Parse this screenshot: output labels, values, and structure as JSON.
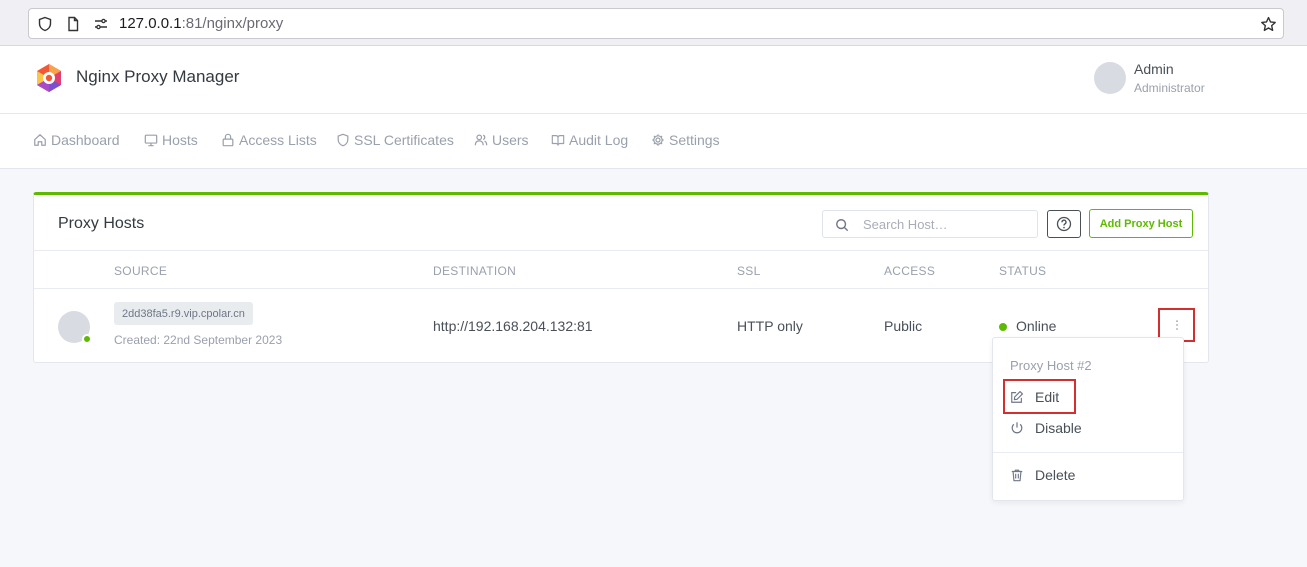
{
  "browser": {
    "url_host": "127.0.0.1",
    "url_rest": ":81/nginx/proxy"
  },
  "header": {
    "brand": "Nginx Proxy Manager",
    "user_name": "Admin",
    "user_role": "Administrator"
  },
  "nav": {
    "items": [
      {
        "label": "Dashboard",
        "icon": "home-icon"
      },
      {
        "label": "Hosts",
        "icon": "monitor-icon"
      },
      {
        "label": "Access Lists",
        "icon": "lock-icon"
      },
      {
        "label": "SSL Certificates",
        "icon": "shield-icon"
      },
      {
        "label": "Users",
        "icon": "users-icon"
      },
      {
        "label": "Audit Log",
        "icon": "book-icon"
      },
      {
        "label": "Settings",
        "icon": "gear-icon"
      }
    ]
  },
  "card": {
    "title": "Proxy Hosts",
    "search_placeholder": "Search Host…",
    "add_button": "Add Proxy Host",
    "columns": [
      "SOURCE",
      "DESTINATION",
      "SSL",
      "ACCESS",
      "STATUS"
    ]
  },
  "rows": [
    {
      "source": "2dd38fa5.r9.vip.cpolar.cn",
      "created": "Created: 22nd September 2023",
      "destination": "http://192.168.204.132:81",
      "ssl": "HTTP only",
      "access": "Public",
      "status": "Online"
    }
  ],
  "dropdown": {
    "header": "Proxy Host #2",
    "edit": "Edit",
    "disable": "Disable",
    "delete": "Delete"
  },
  "colors": {
    "accent": "#5eba00",
    "highlight": "#d32f2f"
  }
}
